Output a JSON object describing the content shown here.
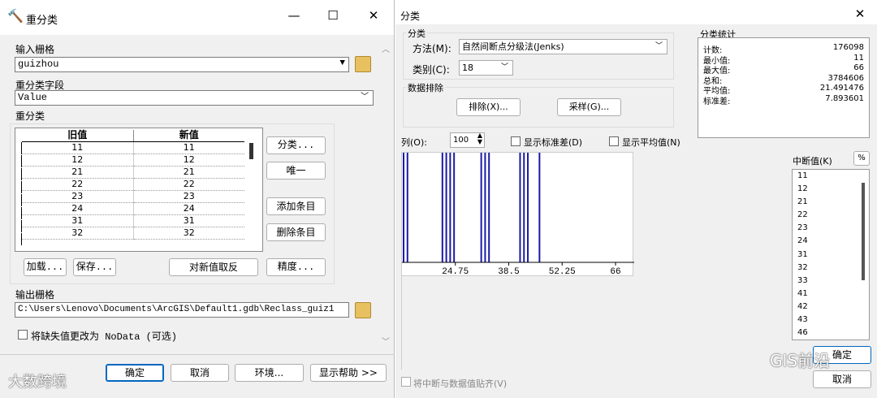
{
  "reclass": {
    "title": "重分类",
    "input_raster_label": "输入栅格",
    "input_raster_value": "guizhou",
    "field_label": "重分类字段",
    "field_value": "Value",
    "reclass_label": "重分类",
    "col_old": "旧值",
    "col_new": "新值",
    "rows": [
      [
        "11",
        "11"
      ],
      [
        "12",
        "12"
      ],
      [
        "21",
        "21"
      ],
      [
        "22",
        "22"
      ],
      [
        "23",
        "23"
      ],
      [
        "24",
        "24"
      ],
      [
        "31",
        "31"
      ],
      [
        "32",
        "32"
      ]
    ],
    "btn_classify": "分类...",
    "btn_unique": "唯一",
    "btn_add": "添加条目",
    "btn_delete": "删除条目",
    "btn_load": "加载...",
    "btn_save": "保存...",
    "btn_reverse": "对新值取反",
    "btn_precision": "精度...",
    "output_label": "输出栅格",
    "output_value": "C:\\Users\\Lenovo\\Documents\\ArcGIS\\Default1.gdb\\Reclass_guiz1",
    "nodata_label": "将缺失值更改为 NoData (可选)",
    "btn_ok": "确定",
    "btn_cancel": "取消",
    "btn_env": "环境...",
    "btn_help": "显示帮助 >>",
    "minimize": "—",
    "maximize": "☐",
    "close": "✕"
  },
  "classification": {
    "title": "分类",
    "close": "✕",
    "group_classify": "分类",
    "method_label": "方法(M):",
    "method_value": "自然间断点分级法(Jenks)",
    "classes_label": "类别(C):",
    "classes_value": "18",
    "group_exclude": "数据排除",
    "btn_exclude": "排除(X)...",
    "btn_sample": "采样(G)...",
    "group_stats": "分类统计",
    "stats": [
      {
        "label": "计数:",
        "value": "176098"
      },
      {
        "label": "最小值:",
        "value": "11"
      },
      {
        "label": "最大值:",
        "value": "66"
      },
      {
        "label": "总和:",
        "value": "3784606"
      },
      {
        "label": "平均值:",
        "value": "21.491476"
      },
      {
        "label": "标准差:",
        "value": "7.893601"
      }
    ],
    "columns_label": "列(O):",
    "columns_value": "100",
    "show_std_label": "显示标准差(D)",
    "show_mean_label": "显示平均值(N)",
    "axis_ticks": [
      "24.75",
      "38.5",
      "52.25",
      "66"
    ],
    "breaks_label": "中断值(K)",
    "percent_btn": "%",
    "breaks": [
      "11",
      "12",
      "21",
      "22",
      "23",
      "24",
      "31",
      "32",
      "33",
      "41",
      "42",
      "43",
      "46"
    ],
    "snap_label": "将中断与数据值贴齐(V)",
    "btn_ok": "确定",
    "btn_cancel": "取消"
  },
  "watermarks": {
    "left": "大数跨境",
    "right": "GIS前沿"
  }
}
